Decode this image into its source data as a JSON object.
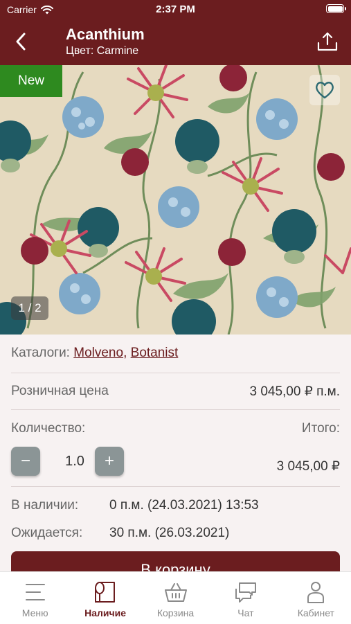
{
  "status_bar": {
    "carrier": "Carrier",
    "time": "2:37 PM"
  },
  "nav": {
    "title": "Acanthium",
    "subtitle": "Цвет: Carmine"
  },
  "gallery": {
    "badge": "New",
    "page_indicator": "1 / 2"
  },
  "details": {
    "catalogs_label": "Каталоги:",
    "catalogs": [
      "Molveno",
      "Botanist"
    ],
    "catalog_separator": ",",
    "retail_price_label": "Розничная цена",
    "retail_price_value": "3 045,00 ₽ п.м.",
    "quantity_label": "Количество:",
    "total_label": "Итого:",
    "quantity_value": "1.0",
    "decrement_symbol": "−",
    "increment_symbol": "+",
    "total_value": "3 045,00 ₽",
    "in_stock_label": "В наличии:",
    "in_stock_value": "0 п.м. (24.03.2021) 13:53",
    "expected_label": "Ожидается:",
    "expected_value": "30 п.м. (26.03.2021)"
  },
  "cart_button": {
    "label": "В корзину"
  },
  "tabs": [
    {
      "label": "Меню",
      "icon": "menu-icon"
    },
    {
      "label": "Наличие",
      "icon": "fabric-roll-icon",
      "active": true
    },
    {
      "label": "Корзина",
      "icon": "basket-icon"
    },
    {
      "label": "Чат",
      "icon": "chat-icon"
    },
    {
      "label": "Кабинет",
      "icon": "person-icon"
    }
  ],
  "colors": {
    "brand": "#6b1d1f",
    "badge_green": "#2e8a1f",
    "stepper": "#8b9596",
    "background": "#f7f2f2"
  }
}
